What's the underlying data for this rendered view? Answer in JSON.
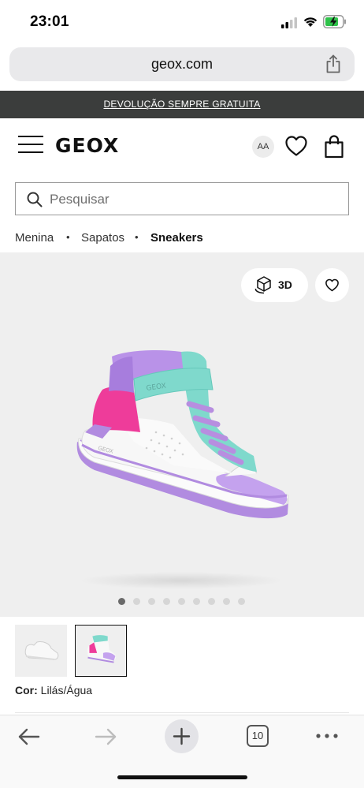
{
  "status_bar": {
    "time": "23:01",
    "icons": [
      "signal-icon",
      "wifi-icon",
      "battery-charging-icon"
    ]
  },
  "browser": {
    "url": "geox.com",
    "tab_count": "10"
  },
  "promo": {
    "text": "DEVOLUÇÃO SEMPRE GRATUITA"
  },
  "header": {
    "logo": "GEOX",
    "accessibility_label": "AA"
  },
  "search": {
    "placeholder": "Pesquisar",
    "value": ""
  },
  "breadcrumb": [
    {
      "label": "Menina"
    },
    {
      "label": "Sapatos"
    },
    {
      "label": "Sneakers",
      "current": true
    }
  ],
  "gallery": {
    "button_3d_label": "3D",
    "dot_count": 9,
    "active_index": 0
  },
  "product": {
    "color_label": "Cor:",
    "color_value": "Lilás/Água"
  },
  "colors": {
    "promo_bg": "#3b3d3c",
    "lilac": "#b78ee0",
    "aqua": "#7fd9cc",
    "pink": "#ee3c9a"
  }
}
